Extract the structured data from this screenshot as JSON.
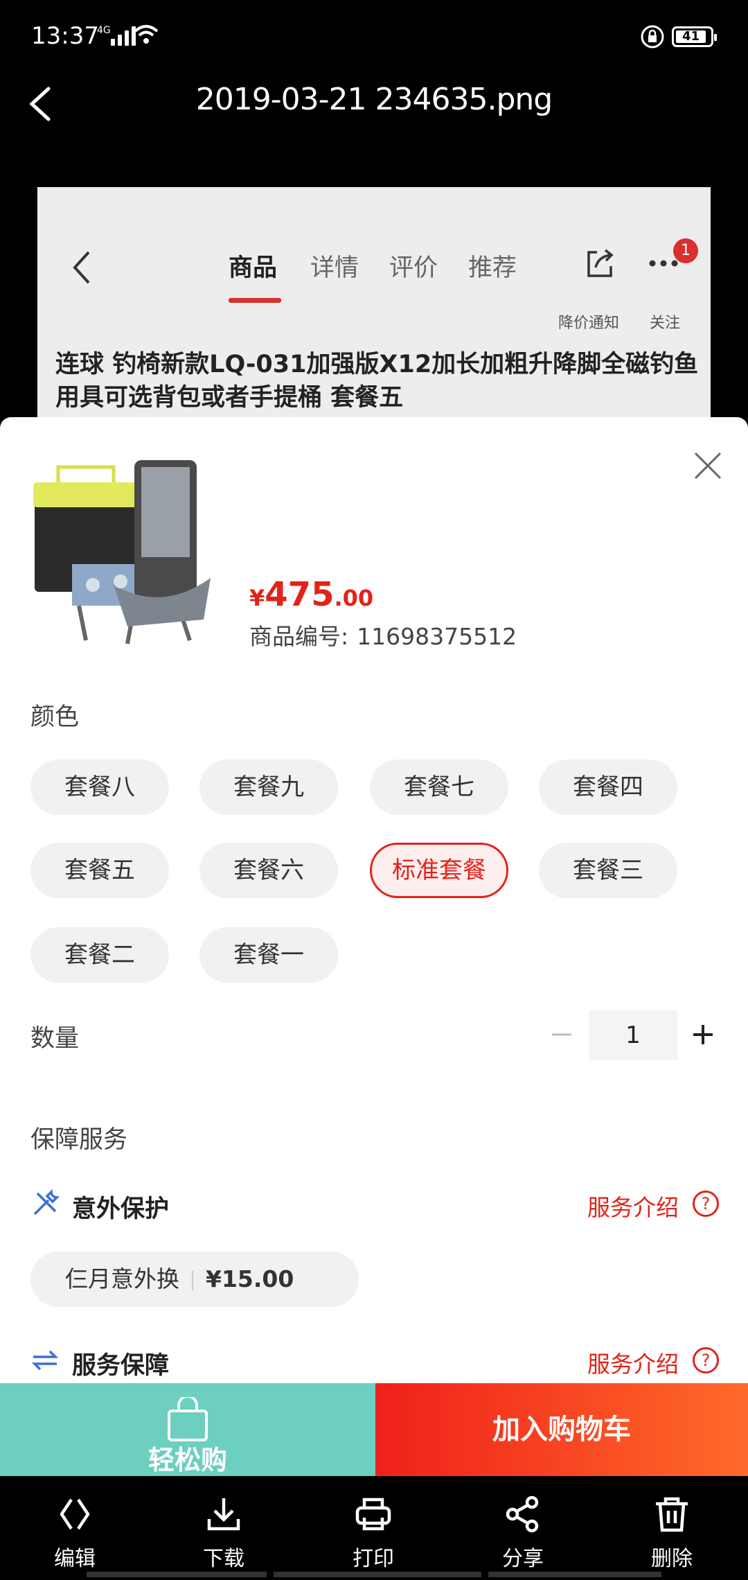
{
  "status": {
    "time": "13:37",
    "network": "4G",
    "battery": "41"
  },
  "viewer": {
    "title": "2019-03-21 234635.png"
  },
  "product_page": {
    "tabs": [
      "商品",
      "详情",
      "评价",
      "推荐"
    ],
    "badge_count": "1",
    "price_drop_label": "降价通知",
    "follow_label": "关注",
    "product_title": "连球 钓椅新款LQ-031加强版X12加长加粗升降脚全磁钓鱼用具可选背包或者手提桶 套餐五"
  },
  "sheet": {
    "price_symbol": "¥",
    "price_int": "475",
    "price_dec": ".00",
    "sku_label": "商品编号:",
    "sku_value": "11698375512",
    "color_label": "颜色",
    "options": [
      "套餐八",
      "套餐九",
      "套餐七",
      "套餐四",
      "套餐五",
      "套餐六",
      "标准套餐",
      "套餐三",
      "套餐二",
      "套餐一"
    ],
    "selected_option": "标准套餐",
    "quantity_label": "数量",
    "quantity": "1",
    "guarantee_label": "保障服务",
    "accident_title": "意外保护",
    "service_intro": "服务介绍",
    "accident_option": "仨月意外换",
    "accident_price": "¥15.00",
    "service_title": "服务保障"
  },
  "actions": {
    "easy_buy": "轻松购",
    "add_to_cart": "加入购物车"
  },
  "toolbar": {
    "edit": "编辑",
    "download": "下载",
    "print": "打印",
    "share": "分享",
    "delete": "删除"
  },
  "colors": {
    "accent": "#e2231a",
    "easy_buy": "#6ccfbf"
  }
}
